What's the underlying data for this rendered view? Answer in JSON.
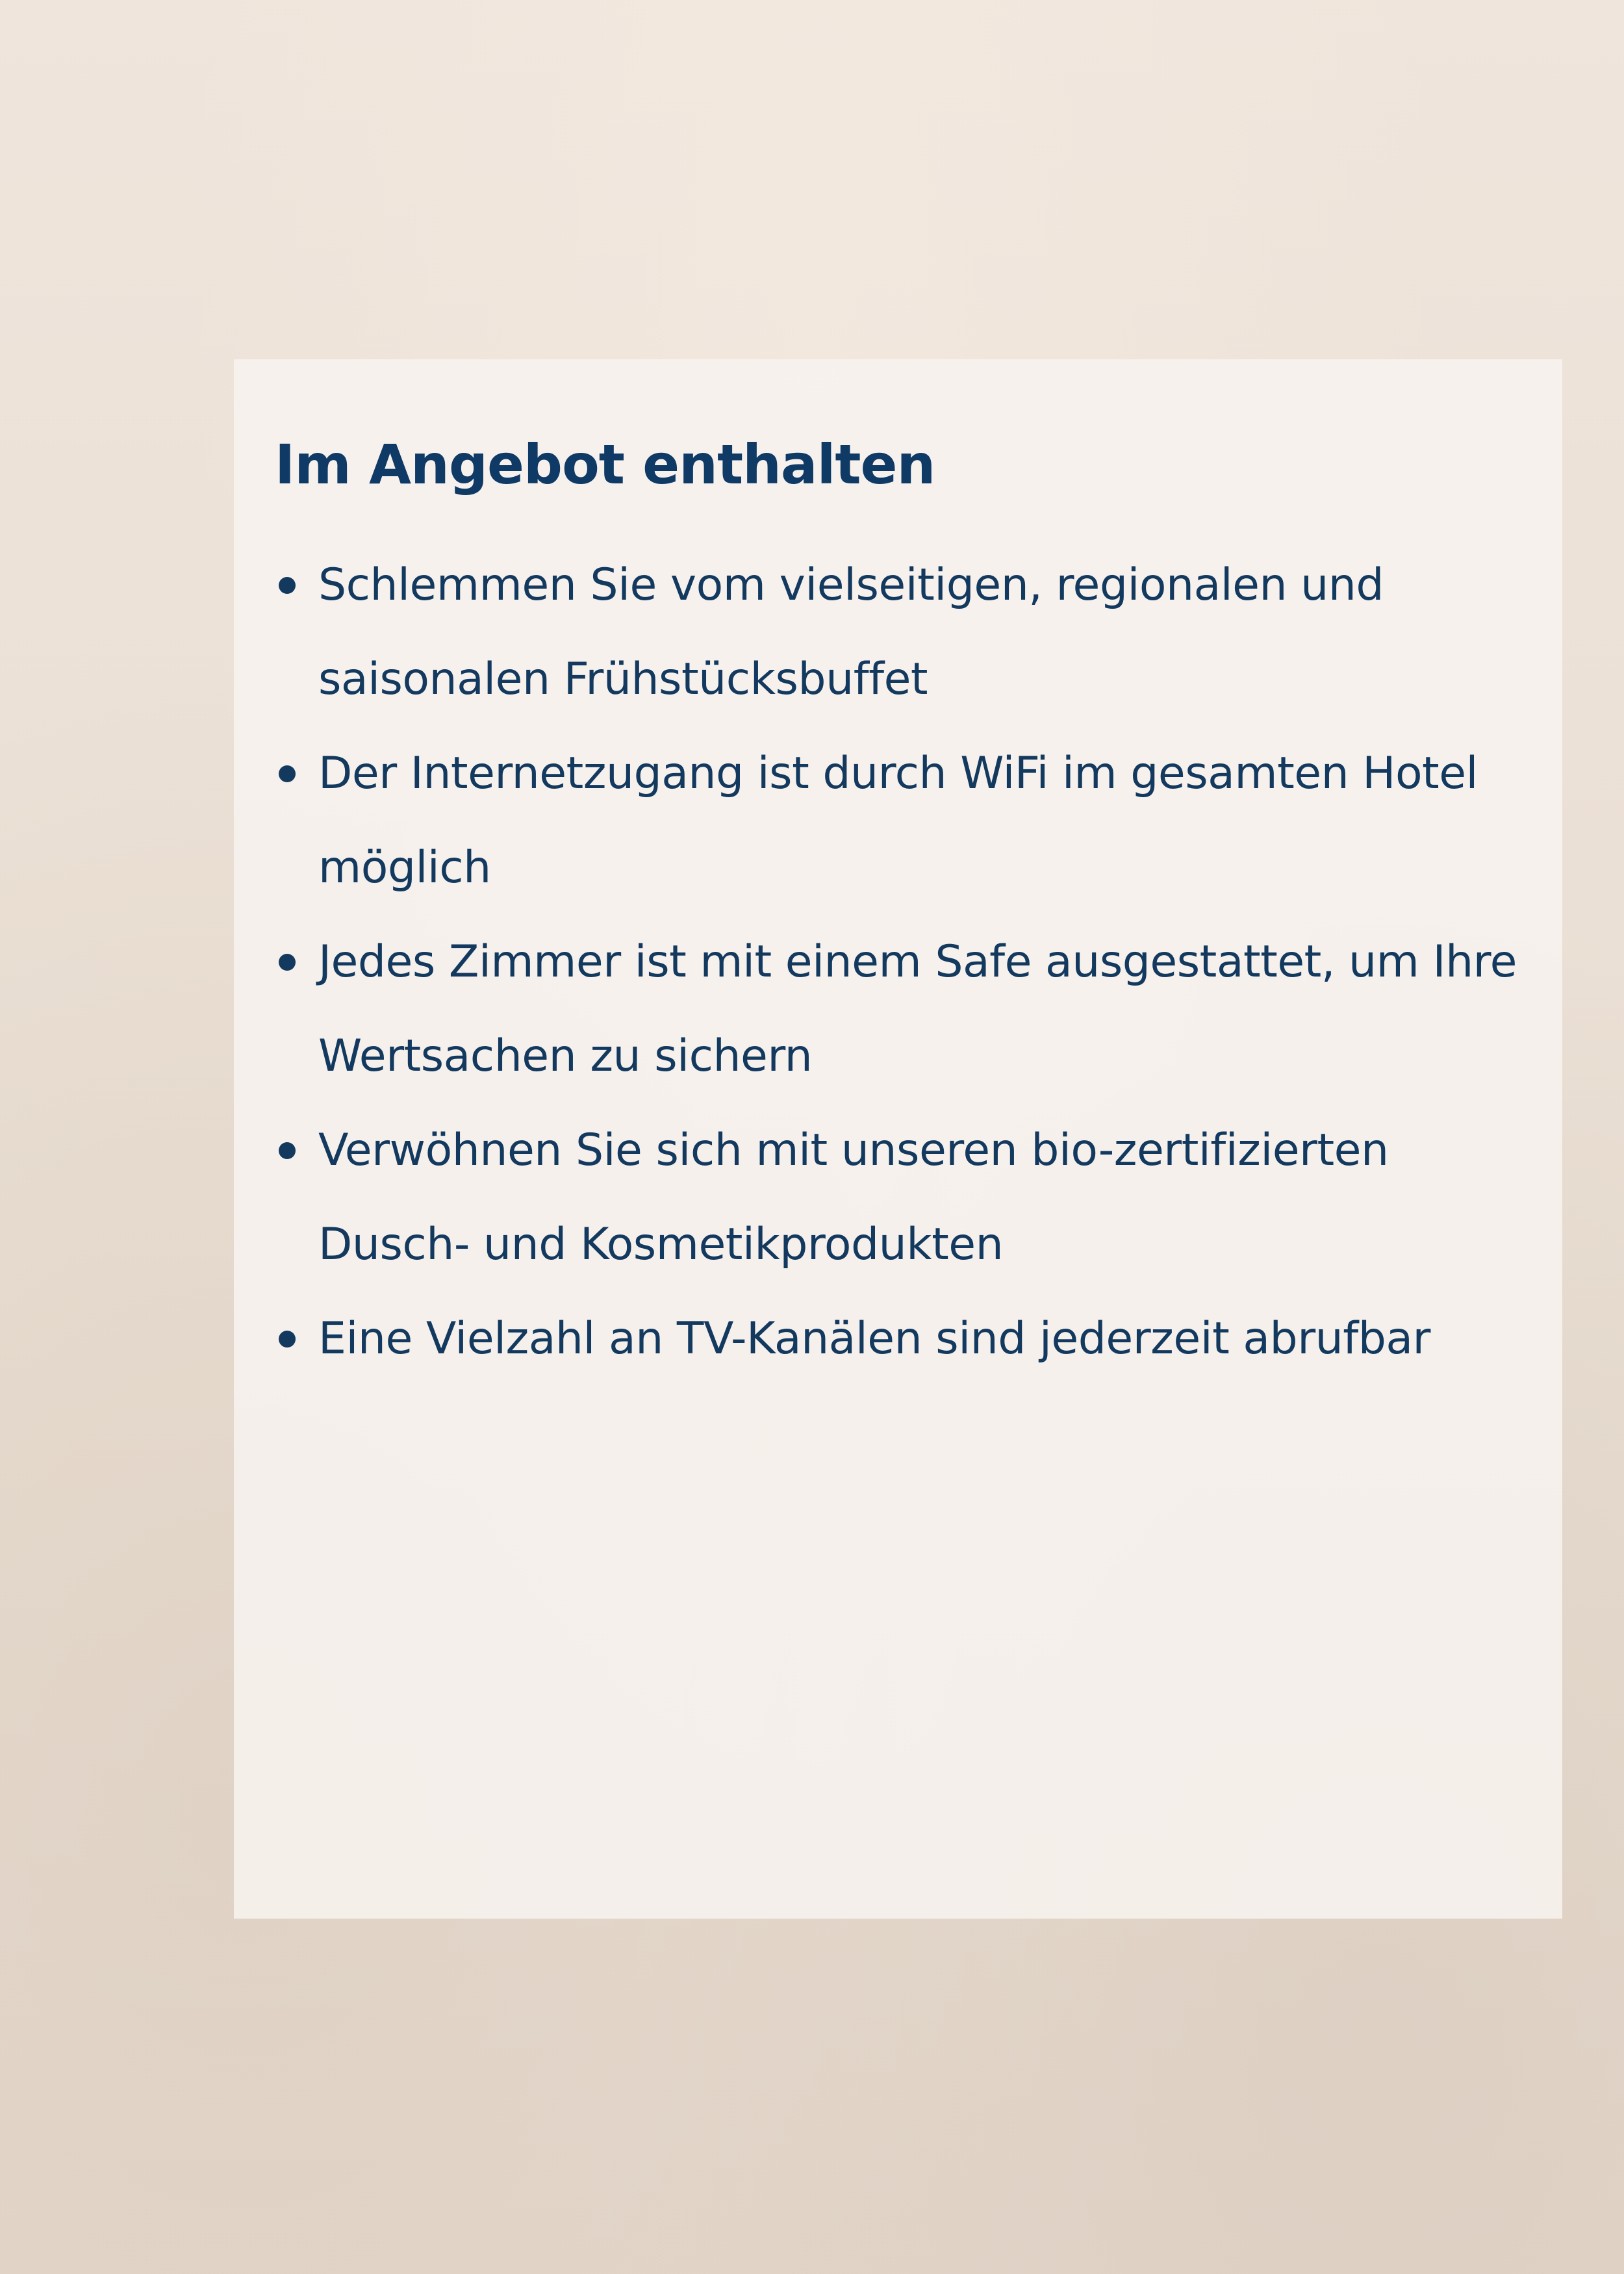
{
  "section": {
    "heading": "Im Angebot enthalten",
    "items": [
      "Schlemmen Sie vom vielseitigen, regionalen und saisonalen Frühstücksbuffet",
      "Der Internetzugang ist durch WiFi im gesamten Hotel möglich",
      "Jedes Zimmer ist mit einem Safe ausgestattet, um Ihre Wertsachen zu sichern",
      "Verwöhnen Sie sich mit unseren bio-zertifizierten Dusch- und Kosmetikprodukten",
      "Eine Vielzahl an TV-Kanälen sind jederzeit abrufbar"
    ]
  },
  "colors": {
    "text": "#13395f",
    "heading": "#0f3a66",
    "card_background": "#f7f3ef",
    "page_background": "#ebe0d5"
  }
}
